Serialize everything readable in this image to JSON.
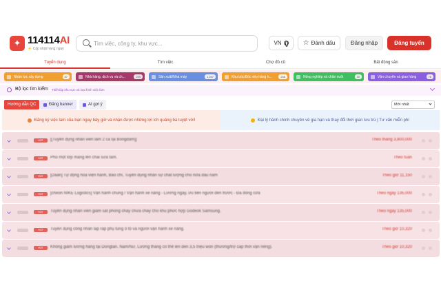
{
  "app": {
    "logo_main": "114114",
    "logo_ai": "AI",
    "logo_sub": "Cập nhật hàng ngày"
  },
  "header": {
    "search_placeholder": "Tìm việc, công ty, khu vực...",
    "lang_label": "VN",
    "save_label": "Đánh dấu",
    "login_label": "Đăng nhập",
    "register_label": "Đăng tuyển"
  },
  "tabs": [
    {
      "label": "Tuyển dụng",
      "active": true
    },
    {
      "label": "Tìm việc",
      "active": false
    },
    {
      "label": "Chợ đồ cũ",
      "active": false
    },
    {
      "label": "Bất động sản",
      "active": false
    }
  ],
  "categories": [
    {
      "label": "Nhân lực xây dựng",
      "count": "87",
      "color": "#f0a030"
    },
    {
      "label": "Nhà hàng, dịch vụ và ch...",
      "count": "239",
      "color": "#a53a6a"
    },
    {
      "label": "Sản xuất/Nhà máy",
      "count": "1,257",
      "color": "#6a8fe0"
    },
    {
      "label": "Khu bốc/Bốc xếp hàng h...",
      "count": "246",
      "color": "#f0a030"
    },
    {
      "label": "Nông nghiệp và chăn nuôi",
      "count": "30",
      "color": "#3fbf5f"
    },
    {
      "label": "Vận chuyển và giao hàng",
      "count": "76",
      "color": "#8a5fe0"
    }
  ],
  "filter": {
    "title": "Bộ lọc tìm kiếm",
    "subtitle": "Thiết lập khu vực và loại hình việc làm"
  },
  "subtabs": {
    "guide": "Hướng dẫn QC",
    "banner": "Đăng banner",
    "ai": "AI gợi ý",
    "sort": "Mới nhất"
  },
  "promo": {
    "left": "Đăng ký việc làm của bạn ngay bây giờ và nhận được những lợi ích quảng bá tuyệt vời!",
    "right": "Đại lý hành chính chuyên về gia hạn và thay đổi thời gian lưu trú | Tư vấn miễn phí"
  },
  "jobs": [
    {
      "title": "[[Tuyển dụng nhân viên làm 2 ca tại Bongdam]]",
      "pay": "Theo tháng 3,800,000"
    },
    {
      "title": "Phủ một lớp màng lên chai sữa tắm.",
      "pay": "Theo tuần"
    },
    {
      "title": "[Daan] Tự động hóa viện hành, Báo chí, Tuyển dụng nhân sự chất lượng cho nửa đầu năm",
      "pay": "Theo giờ 11,150"
    },
    {
      "title": "[cheon NIKE Logistics] Vận hành chung / Vận hành xe nâng - Lương ngày, ưu tiên người đến trước - Đã đóng cửa",
      "pay": "Theo ngày 135,000"
    },
    {
      "title": "Tuyển dụng nhân viên giám sát phòng cháy chữa cháy cho khu phức hợp Godeok Samsung.",
      "pay": "Theo ngày 135,000"
    },
    {
      "title": "Tuyển dụng công nhân lắp ráp phụ tùng ô tô và người vận hành xe nâng.",
      "pay": "Theo giờ 10,320"
    },
    {
      "title": "Không giảm lương hàng tại Dongtan. Nam/Nữ, Lương tháng có thể lên đến 3,5 triệu won (thưởng/trợ cấp thời vận riêng).",
      "pay": "Theo giờ 10,320"
    }
  ],
  "badge_label": "HOT"
}
